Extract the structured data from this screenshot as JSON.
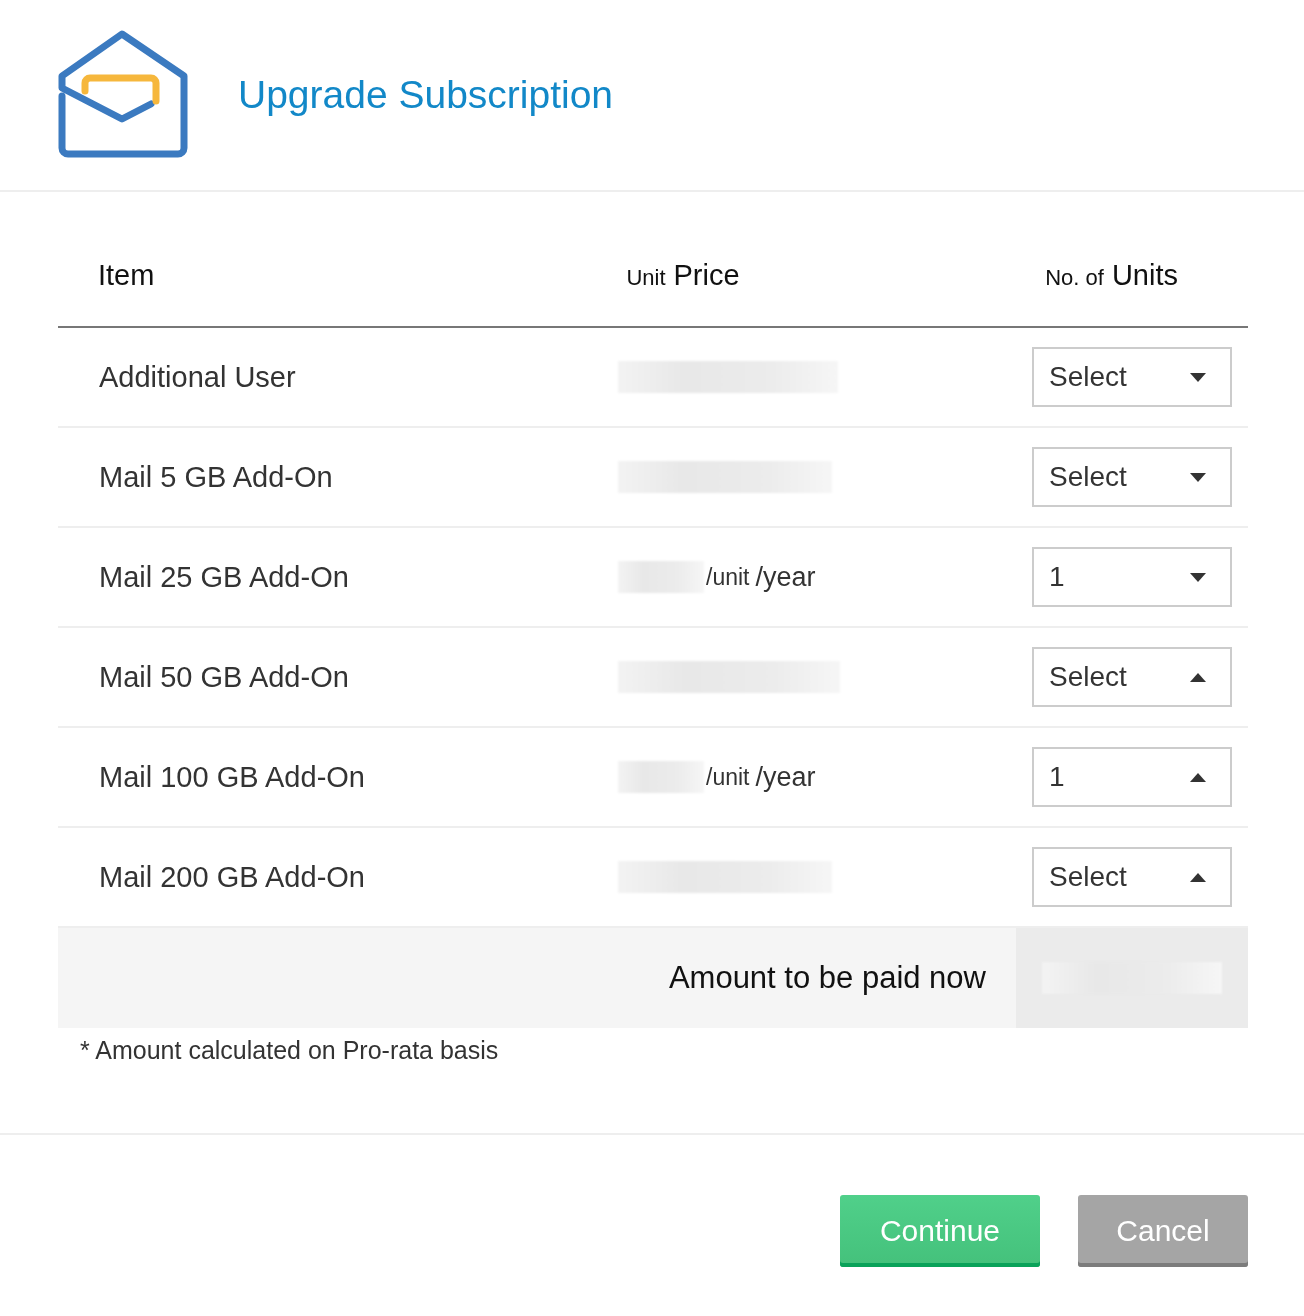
{
  "dialog": {
    "title": "Upgrade Subscription"
  },
  "table": {
    "columns": [
      {
        "parts": [
          "Item"
        ]
      },
      {
        "parts": [
          "Unit",
          "Price"
        ]
      },
      {
        "parts": [
          "No. of",
          "Units"
        ]
      }
    ],
    "rows": [
      {
        "item": "Additional User",
        "price": {
          "kind": "hidden"
        },
        "units": {
          "value": "Select",
          "expanded": false
        }
      },
      {
        "item": "Mail 5 GB Add-On",
        "price": {
          "kind": "hidden"
        },
        "units": {
          "value": "Select",
          "expanded": false
        }
      },
      {
        "item": "Mail 25 GB Add-On",
        "price": {
          "kind": "per_unit",
          "unit": "/unit",
          "period": "/year"
        },
        "units": {
          "value": "1",
          "expanded": false
        }
      },
      {
        "item": "Mail 50 GB Add-On",
        "price": {
          "kind": "hidden"
        },
        "units": {
          "value": "Select",
          "expanded": true
        }
      },
      {
        "item": "Mail 100 GB Add-On",
        "price": {
          "kind": "per_unit",
          "unit": "/unit",
          "period": "/year"
        },
        "units": {
          "value": "1",
          "expanded": true
        }
      },
      {
        "item": "Mail 200 GB Add-On",
        "price": {
          "kind": "hidden"
        },
        "units": {
          "value": "Select",
          "expanded": true
        }
      }
    ],
    "total_label": "Amount to be paid now"
  },
  "note": "* Amount calculated on Pro-rata basis",
  "buttons": [
    {
      "label": "Continue",
      "kind": "primary"
    },
    {
      "label": "Cancel",
      "kind": "secondary"
    }
  ]
}
